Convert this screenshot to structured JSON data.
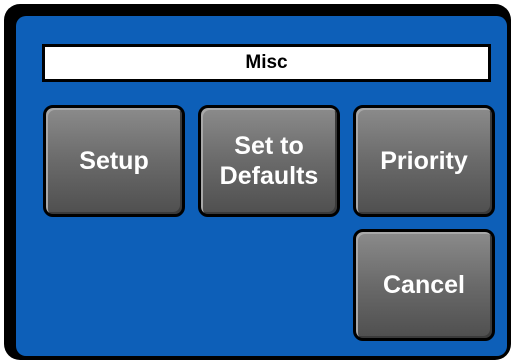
{
  "title": "Misc",
  "buttons": {
    "setup": "Setup",
    "set_to_defaults": "Set to\nDefaults",
    "priority": "Priority",
    "cancel": "Cancel"
  },
  "colors": {
    "panel_background": "#0d5fb8",
    "frame": "#000000",
    "title_background": "#ffffff",
    "button_face": "#6a6a6a",
    "button_text": "#ffffff"
  }
}
